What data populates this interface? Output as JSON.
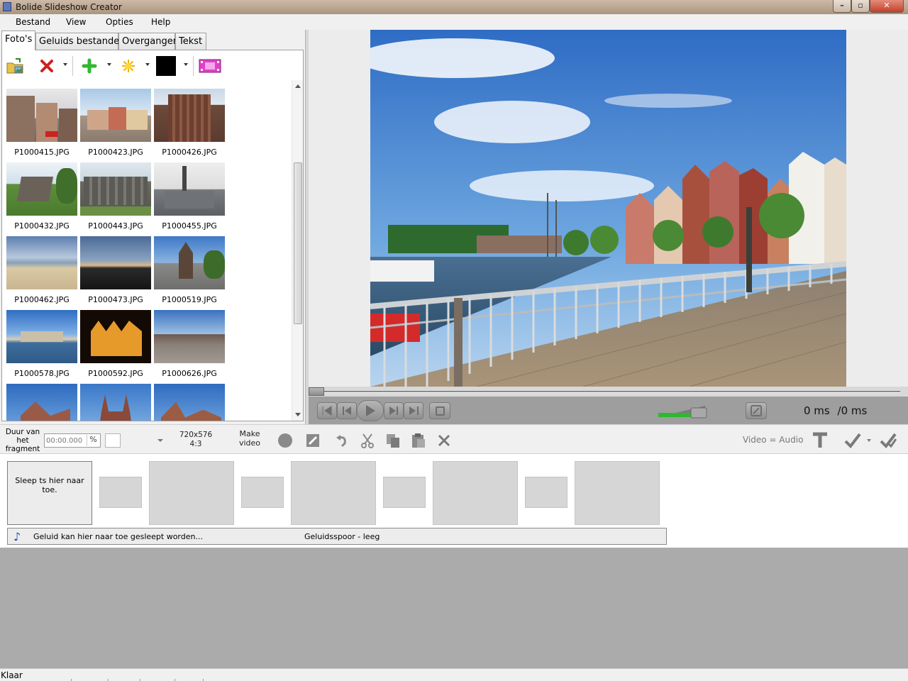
{
  "window": {
    "title": "Bolide Slideshow Creator",
    "minimize": "–",
    "maximize": "▫",
    "close": "✕"
  },
  "menu": [
    "Bestand",
    "View",
    "Opties",
    "Help"
  ],
  "tabs": [
    "Foto's",
    "Geluids bestanden",
    "Overgangen",
    "Tekst"
  ],
  "active_tab": "Foto's",
  "photos": [
    {
      "name": "P1000415.JPG"
    },
    {
      "name": "P1000423.JPG"
    },
    {
      "name": "P1000426.JPG"
    },
    {
      "name": "P1000432.JPG"
    },
    {
      "name": "P1000443.JPG"
    },
    {
      "name": "P1000455.JPG"
    },
    {
      "name": "P1000462.JPG"
    },
    {
      "name": "P1000473.JPG"
    },
    {
      "name": "P1000519.JPG"
    },
    {
      "name": "P1000578.JPG"
    },
    {
      "name": "P1000592.JPG"
    },
    {
      "name": "P1000626.JPG"
    },
    {
      "name": ""
    },
    {
      "name": ""
    },
    {
      "name": ""
    }
  ],
  "player": {
    "time": "0 ms",
    "total": "/0 ms"
  },
  "edit": {
    "duration_label": "Duur van het fragment",
    "duration_value": "00:00.000",
    "percent": "%",
    "resolution": "720x576",
    "aspect": "4:3",
    "make_video": "Make video",
    "video_audio": "Video = Audio"
  },
  "timeline": {
    "drop_hint": "Sleep ts hier naar toe.",
    "audio_hint": "Geluid kan hier naar toe gesleept worden...",
    "audio_status": "Geluidsspoor - leeg"
  },
  "status": "Klaar",
  "colors": {
    "accent_green": "#2fb82f",
    "player_bg": "#9e9e9e",
    "grey_area": "#ababab",
    "audio_note": "#1a52b8"
  }
}
